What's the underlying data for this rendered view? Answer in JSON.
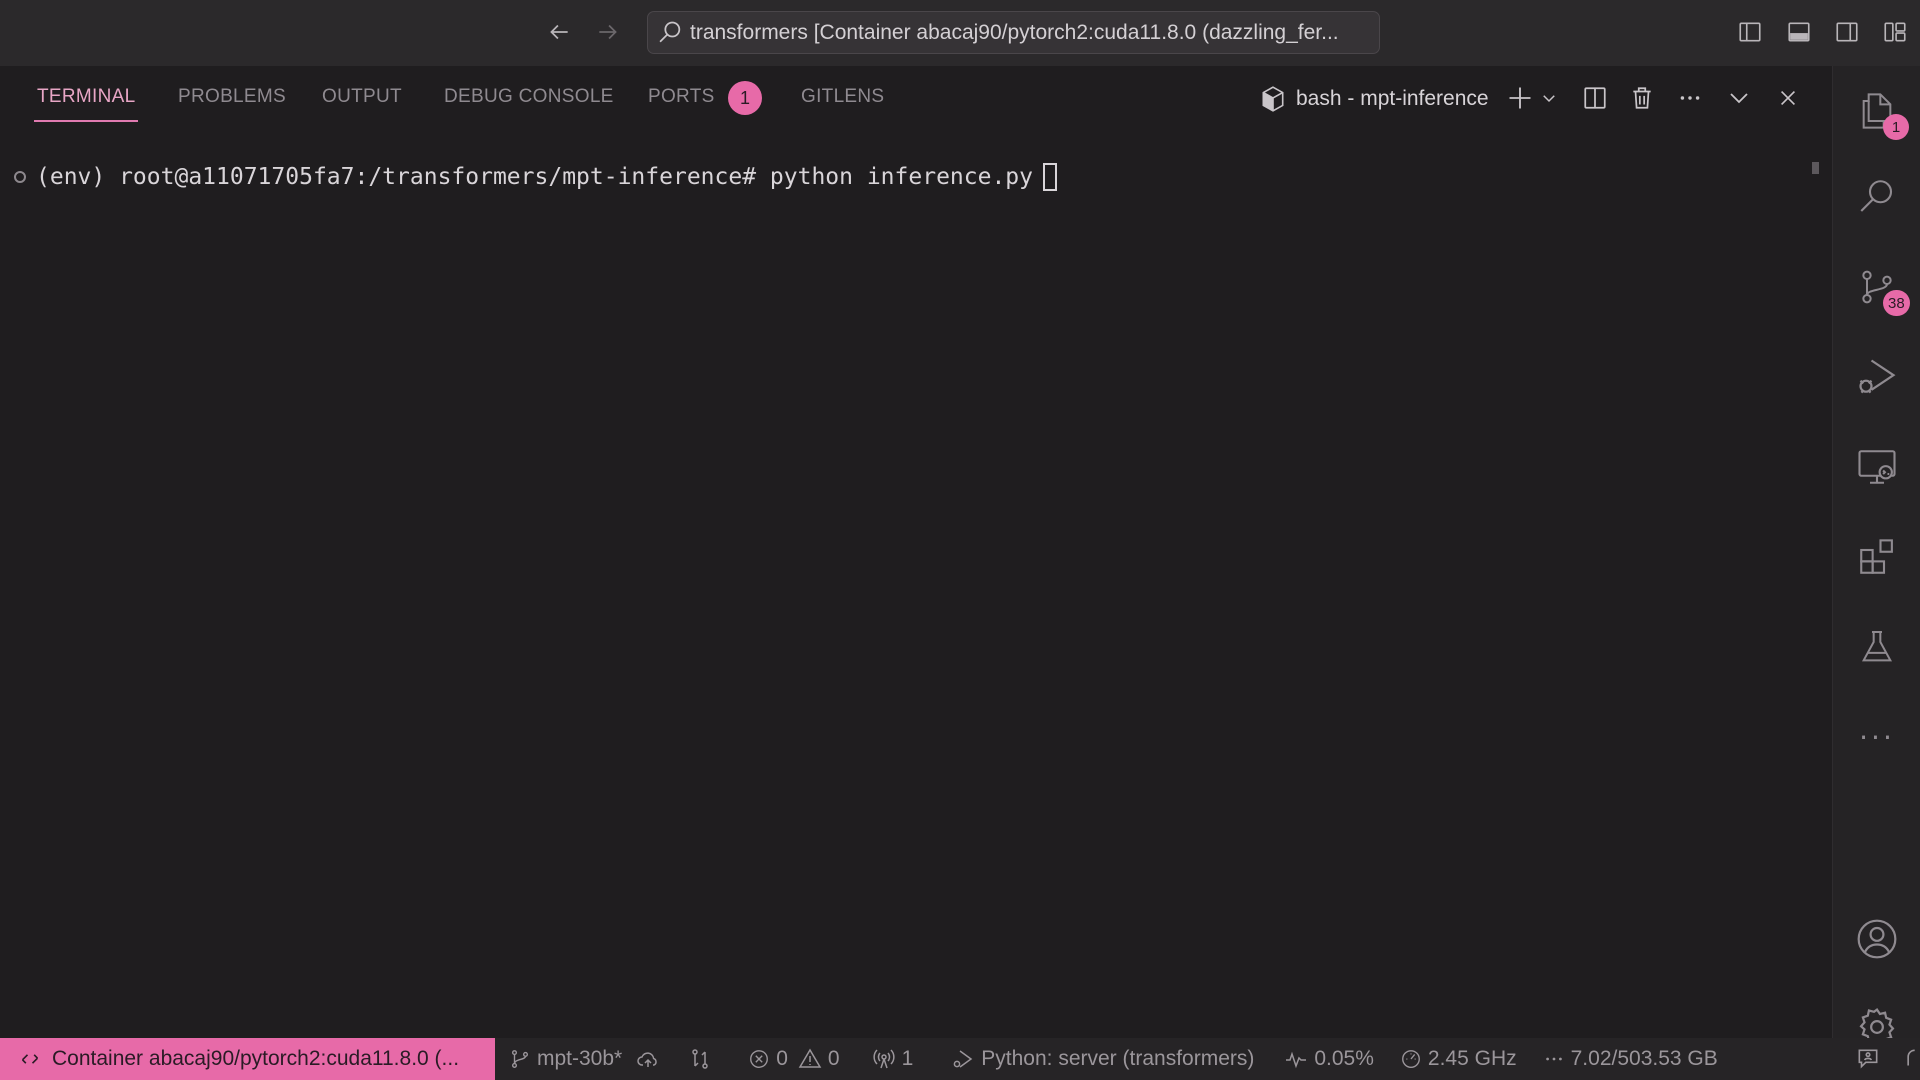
{
  "titlebar": {
    "command_center": "transformers [Container abacaj90/pytorch2:cuda11.8.0 (dazzling_fer..."
  },
  "panel": {
    "tabs": [
      "TERMINAL",
      "PROBLEMS",
      "OUTPUT",
      "DEBUG CONSOLE",
      "PORTS",
      "GITLENS"
    ],
    "ports_badge": "1",
    "terminal_name": "bash - mpt-inference"
  },
  "terminal": {
    "prompt": "(env) root@a11071705fa7:/transformers/mpt-inference# ",
    "command": "python inference.py"
  },
  "activity": {
    "explorer_badge": "1",
    "scm_badge": "38"
  },
  "statusbar": {
    "remote": "Container abacaj90/pytorch2:cuda11.8.0 (...",
    "branch": "mpt-30b*",
    "errors": "0",
    "warnings": "0",
    "ports": "1",
    "python": "Python: server (transformers)",
    "cpu": "0.05%",
    "freq": "2.45 GHz",
    "memory": "7.02/503.53 GB"
  },
  "colors": {
    "accent": "#e76aa8",
    "background": "#1f1d1f",
    "titlebar": "#2b292b"
  }
}
